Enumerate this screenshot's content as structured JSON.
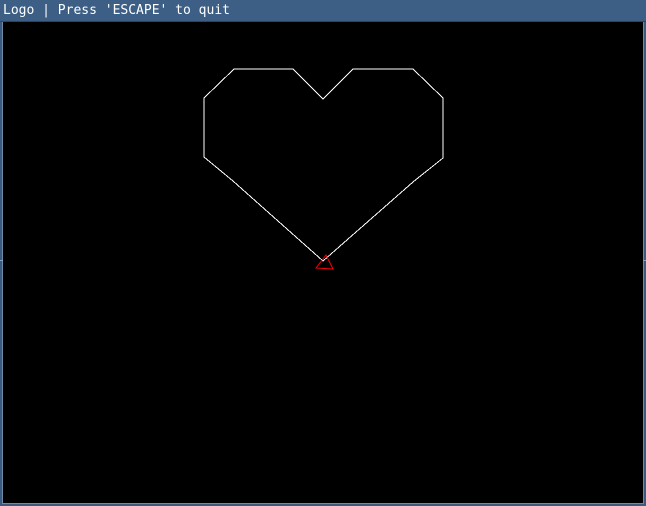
{
  "window": {
    "title": "Logo | Press 'ESCAPE' to quit"
  },
  "canvas": {
    "background_color": "#000000",
    "drawing": {
      "shape": "heart",
      "stroke_color": "#ffffff"
    },
    "turtle": {
      "icon": "turtle-triangle-icon",
      "color": "#ff0000",
      "heading": "north"
    }
  }
}
